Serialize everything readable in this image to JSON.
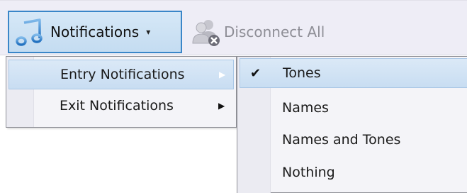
{
  "toolbar": {
    "notifications_label": "Notifications",
    "notifications_icon": "music-note-icon",
    "dropdown_caret": "▾",
    "disconnect_label": "Disconnect All",
    "disconnect_icon": "people-disconnect-icon"
  },
  "menu": {
    "items": [
      {
        "label": "Entry Notifications",
        "arrow": "▶",
        "highlighted": true
      },
      {
        "label": "Exit Notifications",
        "arrow": "▶",
        "highlighted": false
      }
    ]
  },
  "submenu": {
    "check_glyph": "✔",
    "items": [
      {
        "label": "Tones",
        "checked": true,
        "highlighted": true
      },
      {
        "label": "Names",
        "checked": false,
        "highlighted": false
      },
      {
        "label": "Names and Tones",
        "checked": false,
        "highlighted": false
      },
      {
        "label": "Nothing",
        "checked": false,
        "highlighted": false
      }
    ]
  },
  "colors": {
    "toolbar_bg": "#eeedf6",
    "menu_bg": "#f4f4f8",
    "highlight_bg": "#c8ddf2",
    "highlight_border": "#a9c7e6",
    "button_border": "#3a86c8",
    "disabled_text": "#8e8e96"
  }
}
